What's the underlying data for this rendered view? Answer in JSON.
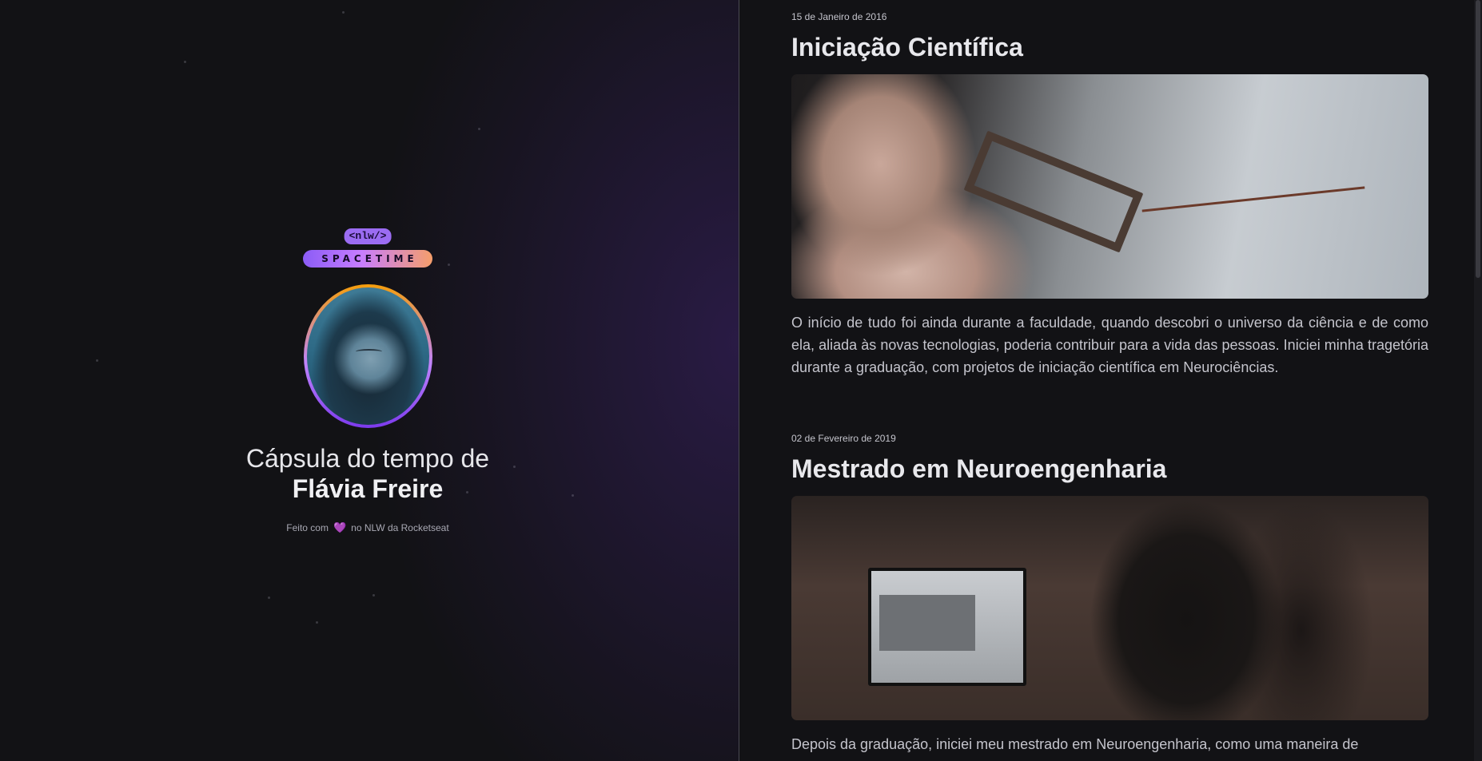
{
  "sidebar": {
    "logo_tag": "<nlw/>",
    "logo_name": "SPACETIME",
    "title_prefix": "Cápsula do tempo de",
    "title_name": "Flávia Freire",
    "made_with_before": "Feito com",
    "made_with_icon": "heart-icon",
    "made_with_after": "no NLW da Rocketseat",
    "colors": {
      "accent": "#9b6cf2",
      "gradient_end": "#f59e6b",
      "background": "#121215"
    }
  },
  "memories": [
    {
      "date": "15 de Janeiro de 2016",
      "title": "Iniciação Científica",
      "text": "O início de tudo foi ainda durante a faculdade, quando descobri o universo da ciência e de como ela, aliada às novas tecnologias, poderia contribuir para a vida das pessoas. Iniciei minha tragetória durante a graduação, com projetos de iniciação científica em Neurociências."
    },
    {
      "date": "02 de Fevereiro de 2019",
      "title": "Mestrado em Neuroengenharia",
      "text": "Depois da graduação, iniciei meu mestrado em Neuroengenharia, como uma maneira de"
    }
  ]
}
